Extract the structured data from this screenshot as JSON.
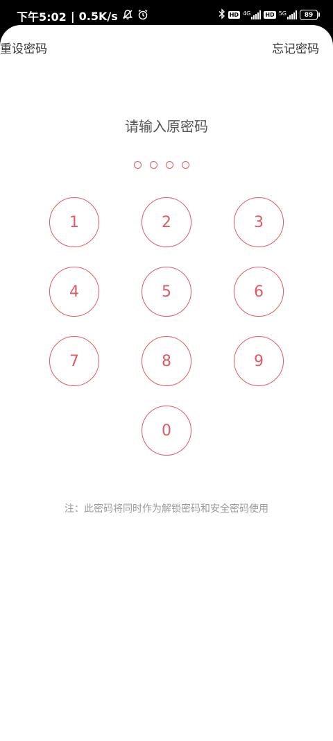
{
  "status_bar": {
    "time": "下午5:02",
    "separator": "|",
    "speed": "0.5K/s",
    "sim1_type": "4G",
    "sim2_type": "5G",
    "hd_label": "HD",
    "battery": "89"
  },
  "header": {
    "reset_label": "重设密码",
    "forget_label": "忘记密码"
  },
  "main": {
    "title": "请输入原密码",
    "keys": [
      "1",
      "2",
      "3",
      "4",
      "5",
      "6",
      "7",
      "8",
      "9",
      "0"
    ],
    "note": "注：此密码将同时作为解锁密码和安全密码使用"
  },
  "colors": {
    "accent": "#e05a65"
  }
}
